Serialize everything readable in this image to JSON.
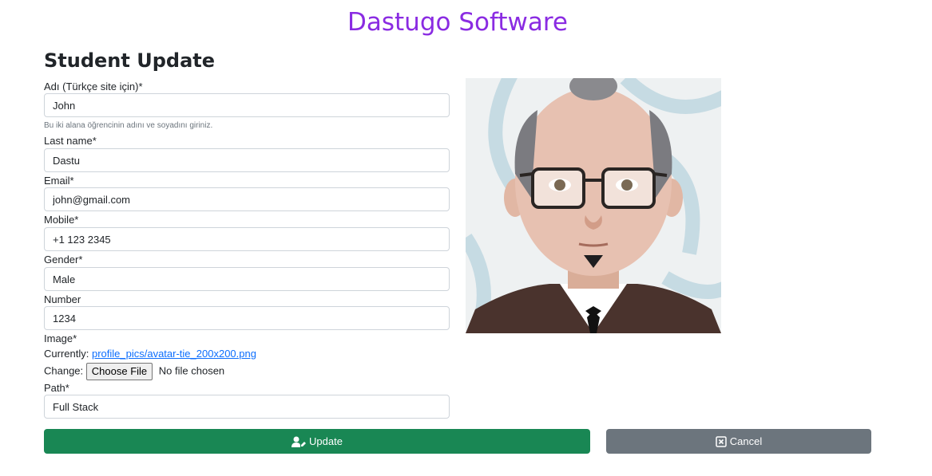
{
  "brand": {
    "title": "Dastugo Software"
  },
  "page": {
    "title": "Student Update"
  },
  "form": {
    "first_name": {
      "label": "Adı (Türkçe site için)*",
      "value": "John",
      "help": "Bu iki alana öğrencinin adını ve soyadını giriniz."
    },
    "last_name": {
      "label": "Last name*",
      "value": "Dastu"
    },
    "email": {
      "label": "Email*",
      "value": "john@gmail.com"
    },
    "mobile": {
      "label": "Mobile*",
      "value": "+1 123 2345"
    },
    "gender": {
      "label": "Gender*",
      "value": "Male"
    },
    "number": {
      "label": "Number",
      "value": "1234"
    },
    "image": {
      "label": "Image*",
      "currently_label": "Currently:",
      "current_file": "profile_pics/avatar-tie_200x200.png",
      "change_label": "Change:",
      "choose_button": "Choose File",
      "no_file": "No file chosen"
    },
    "path": {
      "label": "Path*",
      "value": "Full Stack"
    }
  },
  "buttons": {
    "update": {
      "label": "Update",
      "icon": "user-edit-icon",
      "color": "#198754"
    },
    "cancel": {
      "label": "Cancel",
      "icon": "close-box-icon",
      "color": "#6c757d"
    }
  },
  "colors": {
    "brand": "#8a2be2",
    "link": "#0d6efd"
  }
}
